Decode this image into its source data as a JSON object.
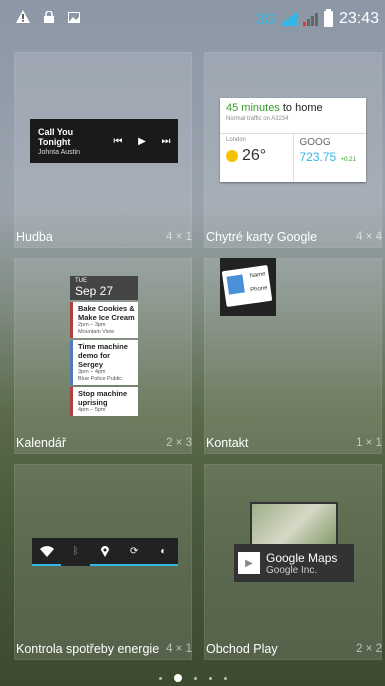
{
  "statusbar": {
    "network": "3G",
    "time": "23:43",
    "left_icons": [
      "warning-icon",
      "lock-icon",
      "image-icon"
    ],
    "accent": "#33b5e5"
  },
  "widgets": [
    {
      "name": "Hudba",
      "size": "4 × 1",
      "music": {
        "title": "Call You Tonight",
        "artist": "Johnta Austin"
      }
    },
    {
      "name": "Chytré karty Google",
      "size": "4 × 4",
      "now": {
        "commute_minutes": "45 minutes",
        "commute_suffix": "to home",
        "traffic": "Normal traffic on A3234",
        "city": "London",
        "temp": "26°",
        "stock": "GOOG",
        "price": "723.75",
        "change": "+0.21"
      }
    },
    {
      "name": "Kalendář",
      "size": "2 × 3",
      "calendar": {
        "dow": "TUE",
        "date": "Sep 27",
        "events": [
          {
            "title": "Bake Cookies & Make Ice Cream",
            "time": "2pm – 3pm",
            "place": "Mountain View"
          },
          {
            "title": "Time machine demo for Sergey",
            "time": "3pm – 4pm",
            "place": "Blue Police Public"
          },
          {
            "title": "Stop machine uprising",
            "time": "4pm – 5pm",
            "place": ""
          }
        ]
      }
    },
    {
      "name": "Kontakt",
      "size": "1 × 1",
      "contact": {
        "name_label": "Name",
        "phone_label": "Phone"
      }
    },
    {
      "name": "Kontrola spotřeby energie",
      "size": "4 × 1",
      "power_icons": [
        "wifi-icon",
        "bluetooth-icon",
        "location-icon",
        "sync-icon",
        "brightness-icon"
      ]
    },
    {
      "name": "Obchod Play",
      "size": "2 × 2",
      "play": {
        "app": "Google Maps",
        "developer": "Google Inc."
      }
    }
  ],
  "pages": {
    "count": 6,
    "current": 2
  }
}
